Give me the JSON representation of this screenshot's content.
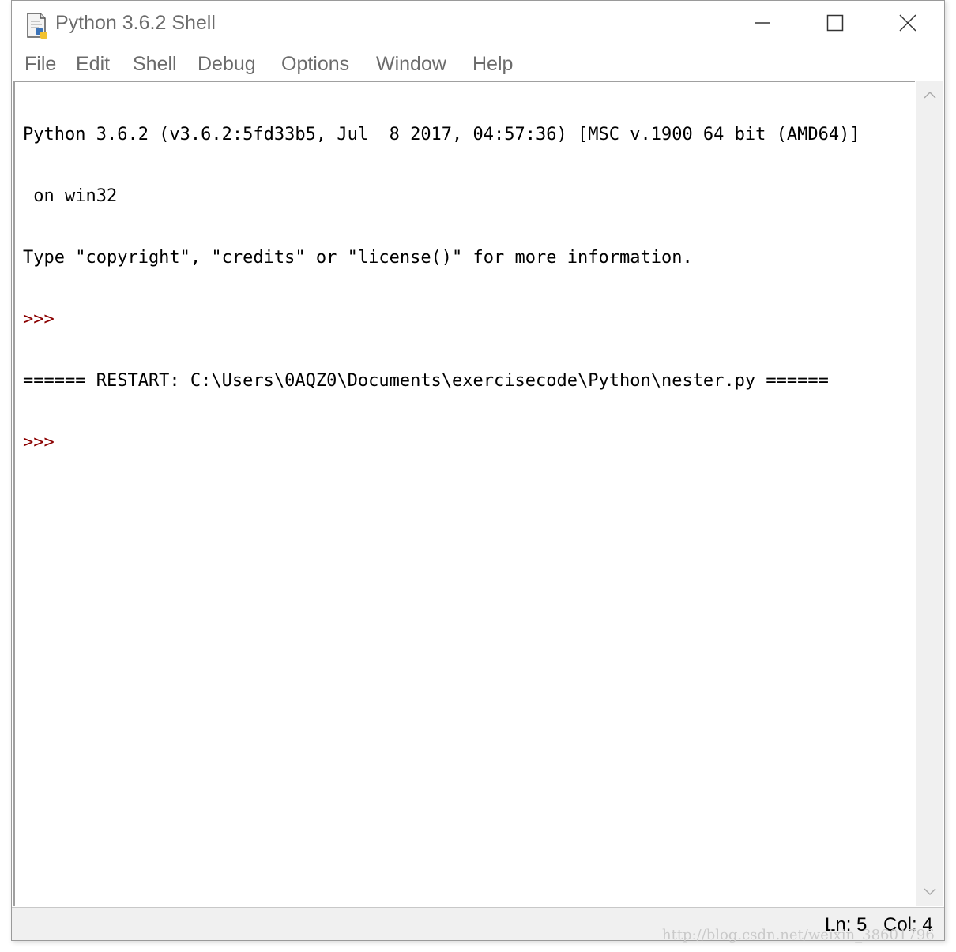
{
  "window": {
    "title": "Python 3.6.2 Shell",
    "icon": "python-idle-file-icon",
    "controls": {
      "minimize": "minimize-icon",
      "maximize": "maximize-icon",
      "close": "close-icon"
    }
  },
  "menubar": {
    "items": [
      "File",
      "Edit",
      "Shell",
      "Debug",
      "Options",
      "Window",
      "Help"
    ]
  },
  "shell": {
    "lines": [
      "Python 3.6.2 (v3.6.2:5fd33b5, Jul  8 2017, 04:57:36) [MSC v.1900 64 bit (AMD64)]",
      " on win32",
      "Type \"copyright\", \"credits\" or \"license()\" for more information.",
      ">>> ",
      "====== RESTART: C:\\Users\\0AQZ0\\Documents\\exercisecode\\Python\\nester.py ======",
      ">>> "
    ],
    "prompt": ">>>",
    "prompt_color": "#8b0000"
  },
  "status": {
    "ln": "Ln: 5",
    "col": "Col: 4"
  },
  "watermark": "http://blog.csdn.net/weixin_38601796",
  "colors": {
    "menu_text": "#6b6b6b",
    "status_bg": "#f0f0f0",
    "prompt": "#8b0000"
  }
}
